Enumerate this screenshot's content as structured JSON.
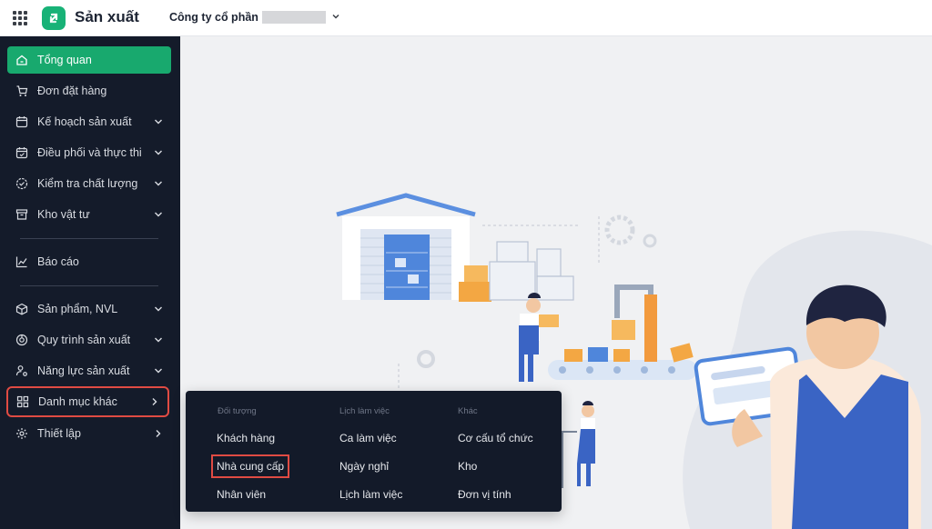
{
  "header": {
    "app_title": "Sản xuất",
    "company_label": "Công ty cổ phần"
  },
  "colors": {
    "brand": "#18b277",
    "active_nav": "#18a96e",
    "sidebar_bg": "#141b2a",
    "highlight": "#e04b43"
  },
  "sidebar": {
    "items": [
      {
        "label": "Tổng quan",
        "icon": "home-icon"
      },
      {
        "label": "Đơn đặt hàng",
        "icon": "cart-icon"
      },
      {
        "label": "Kế hoạch sản xuất",
        "icon": "calendar-icon"
      },
      {
        "label": "Điều phối và thực thi",
        "icon": "calendar-check-icon"
      },
      {
        "label": "Kiểm tra chất lượng",
        "icon": "quality-check-icon"
      },
      {
        "label": "Kho vật tư",
        "icon": "archive-icon"
      },
      {
        "label": "Báo cáo",
        "icon": "chart-icon"
      },
      {
        "label": "Sản phẩm, NVL",
        "icon": "cube-icon"
      },
      {
        "label": "Quy trình sản xuất",
        "icon": "process-icon"
      },
      {
        "label": "Năng lực sản xuất",
        "icon": "user-gear-icon"
      },
      {
        "label": "Danh mục khác",
        "icon": "grid-icon"
      },
      {
        "label": "Thiết lập",
        "icon": "gear-icon"
      }
    ]
  },
  "submenu": {
    "columns": [
      {
        "heading": "Đối tượng",
        "items": [
          "Khách hàng",
          "Nhà cung cấp",
          "Nhân viên"
        ]
      },
      {
        "heading": "Lịch làm việc",
        "items": [
          "Ca làm việc",
          "Ngày nghỉ",
          "Lịch làm việc"
        ]
      },
      {
        "heading": "Khác",
        "items": [
          "Cơ cấu tổ chức",
          "Kho",
          "Đơn vị tính"
        ]
      }
    ]
  }
}
